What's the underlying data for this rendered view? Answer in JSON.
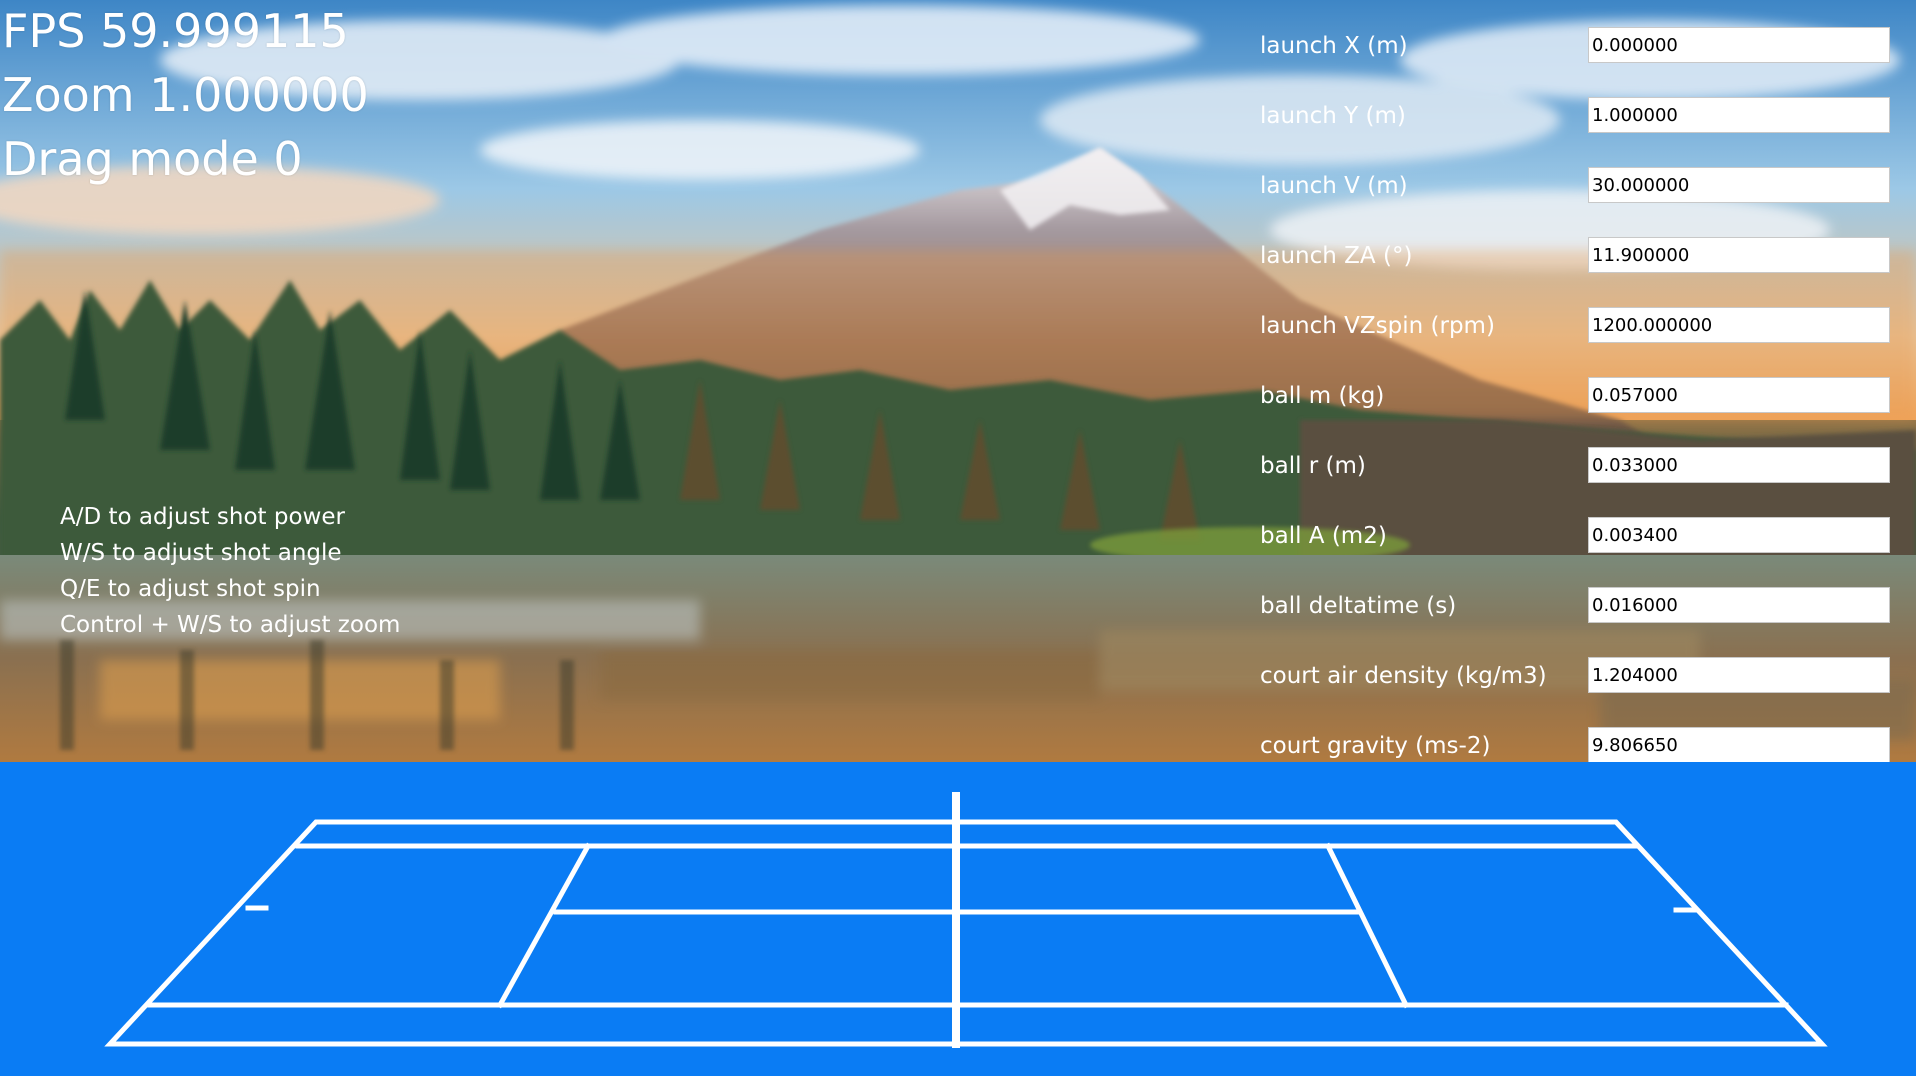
{
  "hud": {
    "fps": "FPS 59.999115",
    "zoom": "Zoom 1.000000",
    "drag_mode": "Drag mode 0"
  },
  "help": [
    "A/D to adjust shot power",
    "W/S to adjust shot angle",
    "Q/E to adjust shot spin",
    "Control + W/S to adjust zoom"
  ],
  "params": [
    {
      "label": "launch X (m)",
      "value": "0.000000"
    },
    {
      "label": "launch Y (m)",
      "value": "1.000000"
    },
    {
      "label": "launch V (m)",
      "value": "30.000000"
    },
    {
      "label": "launch ZA (°)",
      "value": "11.900000"
    },
    {
      "label": "launch VZspin (rpm)",
      "value": "1200.000000"
    },
    {
      "label": "ball m (kg)",
      "value": "0.057000"
    },
    {
      "label": "ball r (m)",
      "value": "0.033000"
    },
    {
      "label": "ball A (m2)",
      "value": "0.003400"
    },
    {
      "label": "ball deltatime (s)",
      "value": "0.016000"
    },
    {
      "label": "court air density (kg/m3)",
      "value": "1.204000"
    },
    {
      "label": "court gravity (ms-2)",
      "value": "9.806650"
    }
  ],
  "colors": {
    "court": "#0a7cf4",
    "court_lines": "#ffffff",
    "text": "#ffffff"
  }
}
